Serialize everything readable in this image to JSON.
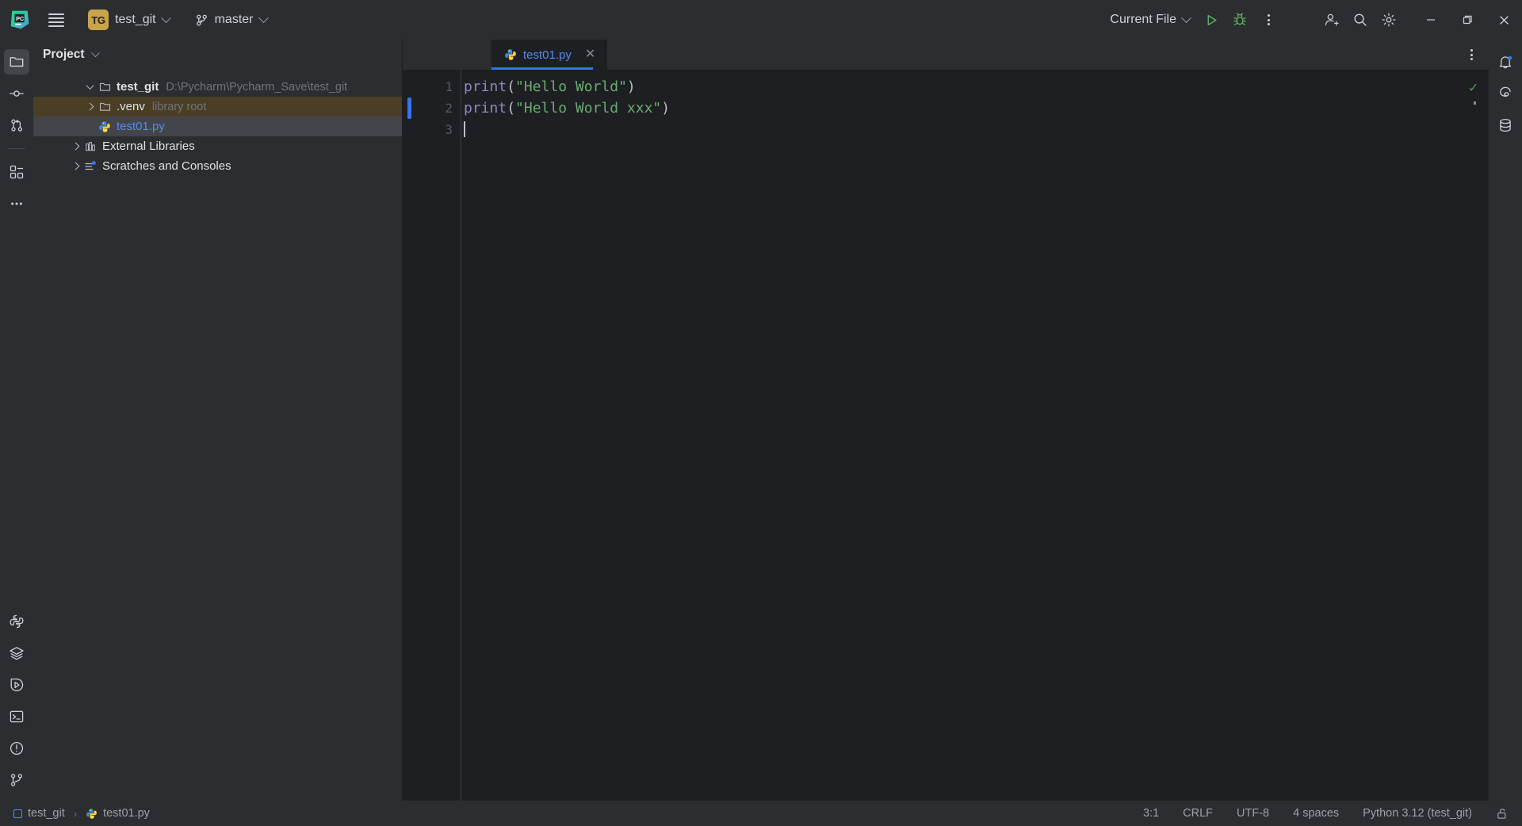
{
  "titlebar": {
    "logo_icon": "pycharm-logo-icon",
    "menu_icon": "hamburger-menu-icon",
    "project_badge": "TG",
    "project_name": "test_git",
    "vcs_icon": "git-branch-icon",
    "branch_name": "master",
    "run_config": "Current File",
    "run_icon": "run-play-icon",
    "debug_icon": "debug-bug-icon",
    "more_icon": "more-vertical-icon",
    "account_icon": "user-add-icon",
    "search_icon": "search-icon",
    "settings_icon": "gear-icon",
    "minimize_icon": "minimize-icon",
    "maximize_icon": "maximize-icon",
    "close_icon": "close-icon"
  },
  "left_stripe": {
    "top": [
      {
        "name": "project",
        "icon": "folder-icon",
        "active": true
      },
      {
        "name": "commit",
        "icon": "commit-icon",
        "active": false
      },
      {
        "name": "pull-requests",
        "icon": "pull-request-icon",
        "active": false
      }
    ],
    "after_divider": [
      {
        "name": "structure",
        "icon": "structure-blocks-icon",
        "active": false
      },
      {
        "name": "more-tool-windows",
        "icon": "more-horizontal-icon",
        "active": false
      }
    ],
    "bottom": [
      {
        "name": "python-packages",
        "icon": "python-icon",
        "active": false
      },
      {
        "name": "services-layers",
        "icon": "layers-icon",
        "active": false
      },
      {
        "name": "run",
        "icon": "run-circle-icon",
        "active": false
      },
      {
        "name": "terminal",
        "icon": "terminal-icon",
        "active": false
      },
      {
        "name": "problems",
        "icon": "warning-circle-icon",
        "active": false
      },
      {
        "name": "version-control",
        "icon": "git-branch-icon",
        "active": false
      }
    ]
  },
  "right_stripe": {
    "items": [
      {
        "name": "notifications",
        "icon": "bell-icon",
        "badge": true
      },
      {
        "name": "ai-assistant",
        "icon": "ai-assistant-icon",
        "badge": false
      },
      {
        "name": "database",
        "icon": "database-icon",
        "badge": false
      }
    ]
  },
  "project_panel": {
    "title": "Project",
    "title_chevron_icon": "chevron-down-icon",
    "tree": [
      {
        "label": "test_git",
        "sublabel": "D:\\Pycharm\\Pycharm_Save\\test_git",
        "icon": "folder-icon",
        "indent": 0,
        "arrow": "open",
        "bold": true,
        "state": "normal",
        "link": false
      },
      {
        "label": ".venv",
        "sublabel": "library root",
        "icon": "folder-icon",
        "indent": 1,
        "arrow": "closed",
        "bold": false,
        "state": "hovered",
        "link": false
      },
      {
        "label": "test01.py",
        "sublabel": "",
        "icon": "python-file-icon",
        "indent": 1,
        "arrow": "none",
        "bold": false,
        "state": "selected",
        "link": true
      },
      {
        "label": "External Libraries",
        "sublabel": "",
        "icon": "library-icon",
        "indent": 0,
        "arrow": "closed",
        "bold": false,
        "state": "normal",
        "link": false
      },
      {
        "label": "Scratches and Consoles",
        "sublabel": "",
        "icon": "scratches-icon",
        "indent": 0,
        "arrow": "closed",
        "bold": false,
        "state": "normal",
        "link": false
      }
    ]
  },
  "editor": {
    "tabs": [
      {
        "label": "test01.py",
        "icon": "python-file-icon",
        "active": true,
        "close_icon": "close-icon"
      }
    ],
    "tab_options_icon": "more-vertical-icon",
    "inspection_icon": "inspection-ok-check",
    "line_numbers": [
      "1",
      "2",
      "3"
    ],
    "lines": [
      {
        "n": "1",
        "func": "print",
        "open": "(",
        "string": "\"Hello World\"",
        "close": ")",
        "modified": false
      },
      {
        "n": "2",
        "func": "print",
        "open": "(",
        "string": "\"Hello World xxx\"",
        "close": ")",
        "modified": true
      },
      {
        "n": "3",
        "func": "",
        "open": "",
        "string": "",
        "close": "",
        "modified": false
      }
    ]
  },
  "statusbar": {
    "breadcrumb": [
      {
        "label": "test_git",
        "icon": "module-square-icon"
      },
      {
        "label": "test01.py",
        "icon": "python-file-icon"
      }
    ],
    "separator": "›",
    "caret_position": "3:1",
    "line_separator": "CRLF",
    "encoding": "UTF-8",
    "indent": "4 spaces",
    "interpreter": "Python 3.12 (test_git)",
    "lock_icon": "unlocked-icon"
  },
  "colors": {
    "bg_panel": "#2b2d30",
    "bg_editor": "#1e1f22",
    "accent_blue": "#3574f0",
    "link_blue": "#548af7",
    "string_green": "#6aab73",
    "keyword_violet": "#8888c6",
    "hover_olive": "#4a3f24",
    "badge_gold": "#c9a34a"
  }
}
